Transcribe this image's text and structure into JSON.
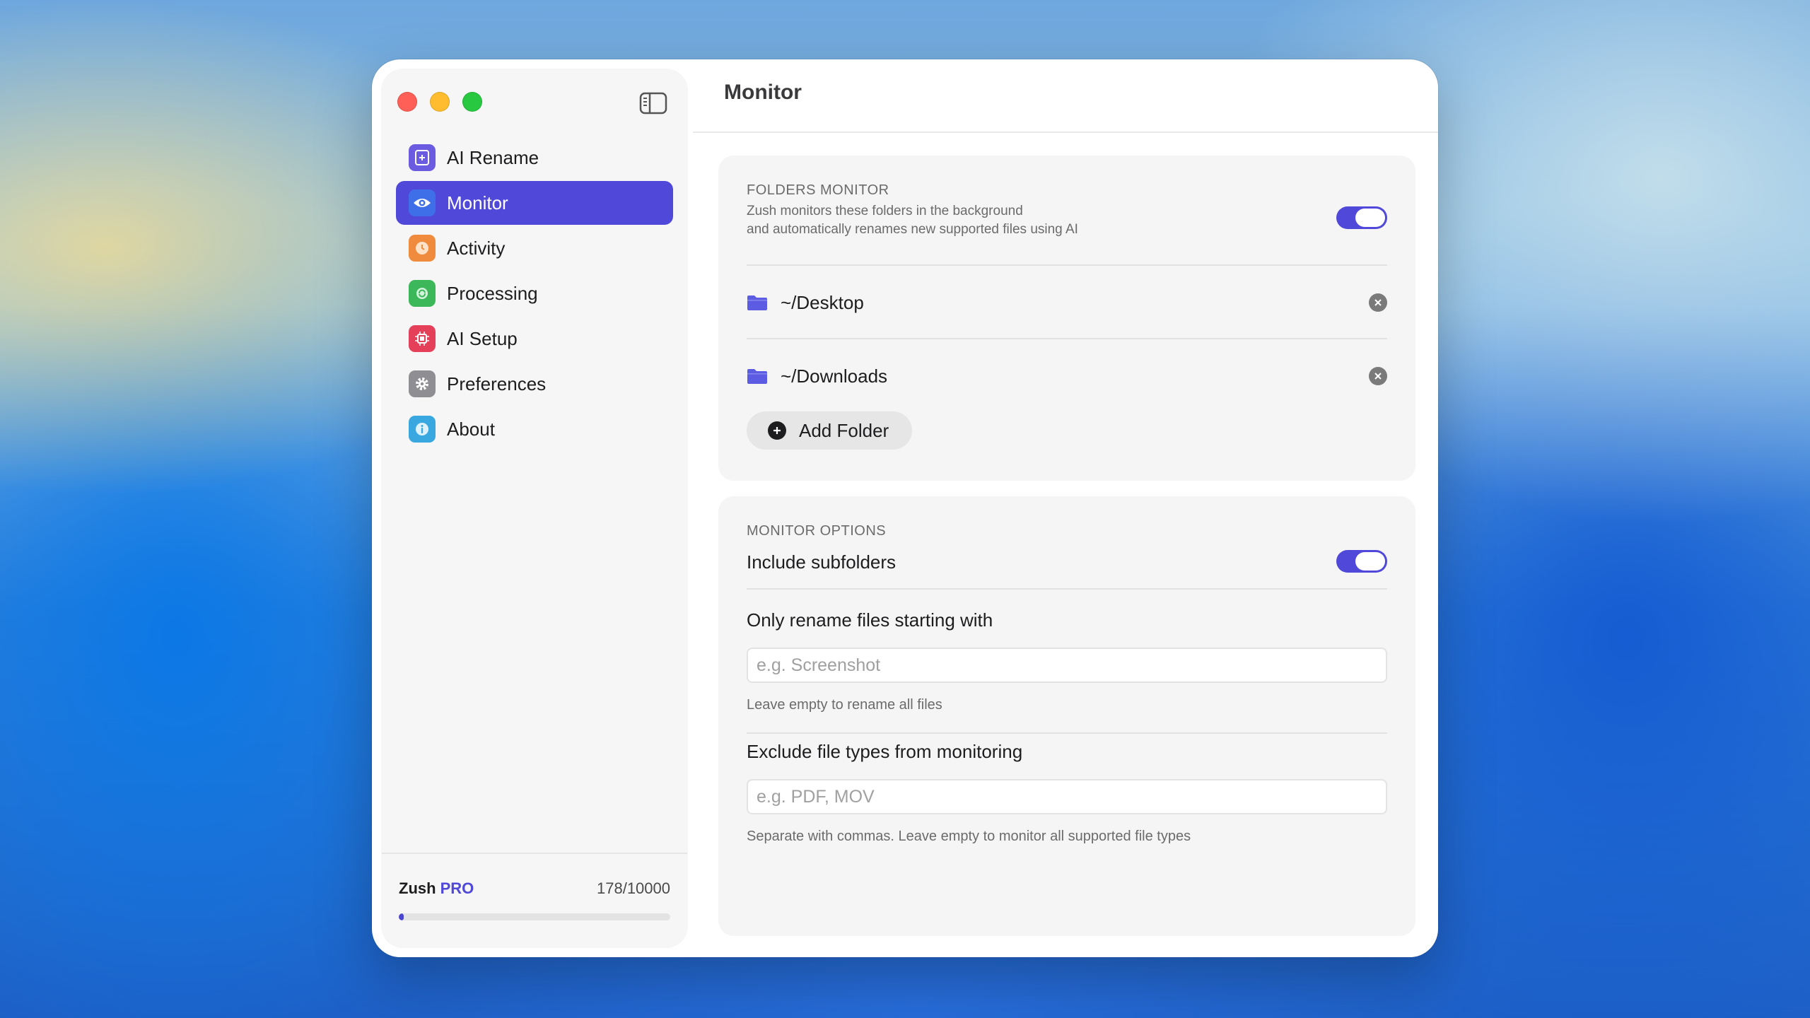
{
  "sidebar": {
    "items": [
      {
        "label": "AI Rename",
        "icon": "ai-rename-icon",
        "color": "#6b5be0"
      },
      {
        "label": "Monitor",
        "icon": "eye-icon",
        "color": "#3f6fe8"
      },
      {
        "label": "Activity",
        "icon": "clock-icon",
        "color": "#f08a3c"
      },
      {
        "label": "Processing",
        "icon": "refresh-icon",
        "color": "#3cb85a"
      },
      {
        "label": "AI Setup",
        "icon": "chip-icon",
        "color": "#e5405a"
      },
      {
        "label": "Preferences",
        "icon": "gear-icon",
        "color": "#8e8e93"
      },
      {
        "label": "About",
        "icon": "info-icon",
        "color": "#39a8e0"
      }
    ],
    "active": "Monitor",
    "footer": {
      "plan_name": "Zush",
      "plan_tier": "PRO",
      "usage": "178/10000",
      "usage_fraction": 0.0178
    }
  },
  "header": {
    "title": "Monitor"
  },
  "folders_monitor": {
    "title": "FOLDERS MONITOR",
    "description_line1": "Zush monitors these folders in the background",
    "description_line2": "and automatically renames new supported files using AI",
    "enabled": true,
    "folders": [
      {
        "path": "~/Desktop"
      },
      {
        "path": "~/Downloads"
      }
    ],
    "add_folder_label": "Add Folder"
  },
  "monitor_options": {
    "title": "MONITOR OPTIONS",
    "include_subfolders_label": "Include subfolders",
    "include_subfolders_enabled": true,
    "prefix_label": "Only rename files starting with",
    "prefix_placeholder": "e.g. Screenshot",
    "prefix_value": "",
    "prefix_hint": "Leave empty to rename all files",
    "exclude_label": "Exclude file types from monitoring",
    "exclude_placeholder": "e.g. PDF, MOV",
    "exclude_value": "",
    "exclude_hint": "Separate with commas. Leave empty to monitor all supported file types"
  },
  "colors": {
    "accent": "#5048d8",
    "folder_icon": "#5b5ce2"
  }
}
